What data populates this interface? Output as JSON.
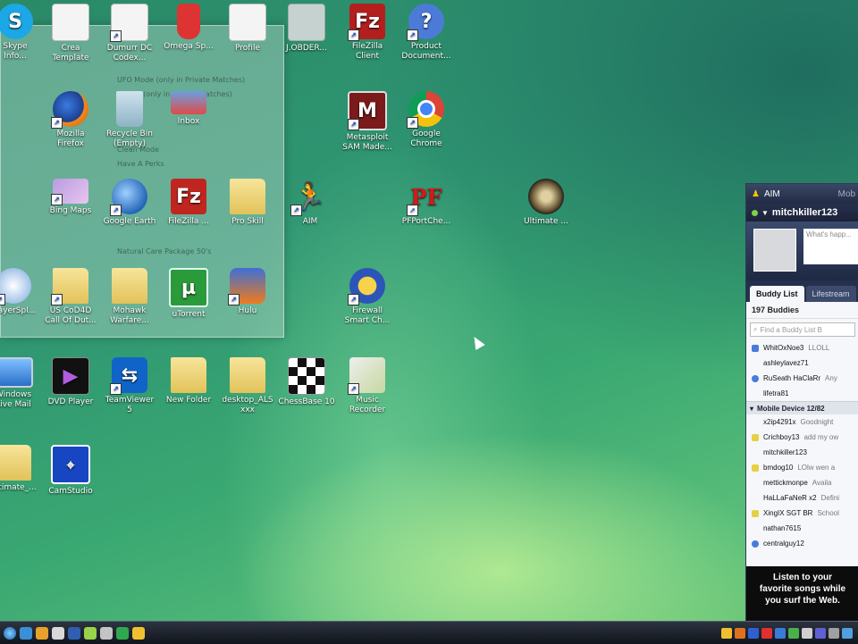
{
  "desktop": {
    "icons": [
      {
        "label": "Skype\nInfo...",
        "icon": "skype-icon"
      },
      {
        "label": "Crea\nTemplate",
        "icon": "document-icon"
      },
      {
        "label": "Dumurr DC\nCodex...",
        "icon": "document-icon"
      },
      {
        "label": "Omega Sp...",
        "icon": "cup-icon"
      },
      {
        "label": "Profile",
        "icon": "document-icon"
      },
      {
        "label": "J.OBDER...",
        "icon": "document-icon"
      },
      {
        "label": "FileZilla\nClient",
        "icon": "filezilla-icon"
      },
      {
        "label": "Product\nDocument...",
        "icon": "help-icon"
      },
      {
        "label": "Mozilla\nFirefox",
        "icon": "firefox-icon"
      },
      {
        "label": "Recycle Bin\n(Empty)",
        "icon": "recycle-bin-icon"
      },
      {
        "label": "Inbox",
        "icon": "inbox-icon"
      },
      {
        "label": "Metasploit\nSAM Made...",
        "icon": "m-icon"
      },
      {
        "label": "Google\nChrome",
        "icon": "chrome-icon"
      },
      {
        "label": "Bing Maps",
        "icon": "bing-icon"
      },
      {
        "label": "Google Earth",
        "icon": "google-earth-icon"
      },
      {
        "label": "FileZilla ...",
        "icon": "filezilla-icon"
      },
      {
        "label": "Pro Skill",
        "icon": "folder-icon"
      },
      {
        "label": "AIM",
        "icon": "aim-running-man-icon"
      },
      {
        "label": "PFPortChe...",
        "icon": "pf-icon"
      },
      {
        "label": "Ultimate ...",
        "icon": "crosshair-icon"
      },
      {
        "label": "PlayerSpl...",
        "icon": "player-icon"
      },
      {
        "label": "US CoD4D\nCall Of Dut...",
        "icon": "folder-icon"
      },
      {
        "label": "Mohawk\nWarfare...",
        "icon": "folder-icon"
      },
      {
        "label": "uTorrent",
        "icon": "utorrent-icon"
      },
      {
        "label": "Hulu",
        "icon": "hulu-icon"
      },
      {
        "label": "Firewall\nSmart Ch...",
        "icon": "shield-icon"
      },
      {
        "label": "Windows\nLive Mail",
        "icon": "monitor-icon"
      },
      {
        "label": "DVD Player",
        "icon": "dvd-icon"
      },
      {
        "label": "TeamViewer\n5",
        "icon": "teamviewer-icon"
      },
      {
        "label": "New Folder",
        "icon": "folder-icon"
      },
      {
        "label": "desktop_ALS\nxxx",
        "icon": "folder-icon"
      },
      {
        "label": "ChessBase 10",
        "icon": "chess-icon"
      },
      {
        "label": "Music\nRecorder",
        "icon": "paint-icon"
      },
      {
        "label": "Ultimate_...",
        "icon": "folder-icon"
      },
      {
        "label": "CamStudio",
        "icon": "camstudio-icon"
      }
    ],
    "ghost_window": {
      "lines": [
        "UFO Mode (only in Private Matches)",
        "Scouts (only in Private Matches)",
        "Clean Mode",
        "Have A Perks",
        "Natural Care Package 50's"
      ]
    }
  },
  "aim": {
    "title": "AIM",
    "title_right": "Mob",
    "screen_name": "mitchkiller123",
    "status_placeholder": "What's happ...",
    "tabs": [
      "Buddy List",
      "Lifestream"
    ],
    "buddy_count": "197 Buddies",
    "search_placeholder": "Find a Buddy List B",
    "buddies_top": [
      {
        "name": "WhitOxNoe3",
        "status": "LLOLL",
        "color": "#4a7bd8"
      },
      {
        "name": "ashleylavez71",
        "status": "",
        "color": ""
      },
      {
        "name": "RuSeath HaClaRr",
        "status": "Any",
        "color": "#4a7bd8"
      },
      {
        "name": "lifetra81",
        "status": "",
        "color": ""
      }
    ],
    "group_name": "Mobile Device 12/82",
    "buddies_group": [
      {
        "name": "x2ip4291x",
        "status": "Goodnight",
        "color": ""
      },
      {
        "name": "Crichboy13",
        "status": "add my ow",
        "color": "#e8d044"
      },
      {
        "name": "mitchkiller123",
        "status": "",
        "color": ""
      },
      {
        "name": "bmdog10",
        "status": "LOlw wen a",
        "color": "#e8d044"
      },
      {
        "name": "mettickmonpe",
        "status": "Availa",
        "color": ""
      },
      {
        "name": "HaLLaFaNeR x2",
        "status": "Defini",
        "color": ""
      },
      {
        "name": "XingIX SGT BR",
        "status": "School",
        "color": "#e8d044"
      },
      {
        "name": "nathan7615",
        "status": "",
        "color": ""
      },
      {
        "name": "centralguy12",
        "status": "",
        "color": "#4a7bd8"
      }
    ],
    "ad_text": [
      "Listen to your",
      "favorite songs while",
      "you surf the Web."
    ]
  },
  "taskbar": {
    "quick_launch": [
      "#3b8fd6",
      "#e7a12a",
      "#d9d9d9",
      "#2f5fb0",
      "#9ad24a",
      "#c4c4c4",
      "#2fa84f",
      "#f0c030"
    ],
    "tray": [
      "#f0c030",
      "#e07020",
      "#3060d0",
      "#e03030",
      "#3a7ad8",
      "#4ab04a",
      "#d0d0d0",
      "#6060d0",
      "#a0a0a0",
      "#50a0e0"
    ]
  }
}
